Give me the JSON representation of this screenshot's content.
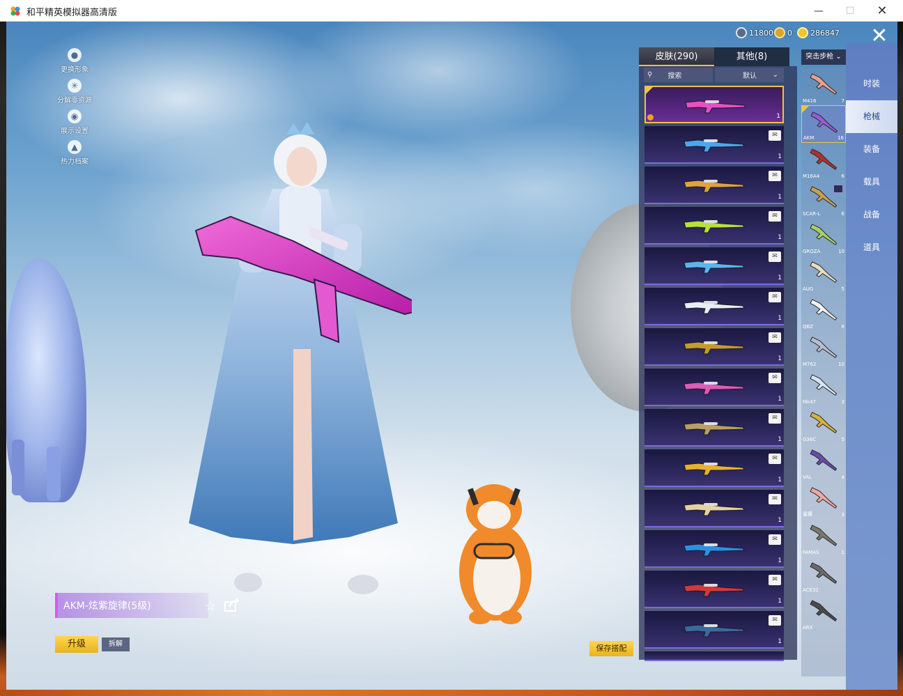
{
  "window": {
    "title": "和平精英模拟器高清版"
  },
  "side_menu": [
    {
      "label": "更换形象",
      "icon": "person-icon"
    },
    {
      "label": "分解零资源",
      "icon": "gear-icon"
    },
    {
      "label": "展示设置",
      "icon": "eye-icon"
    },
    {
      "label": "热力档案",
      "icon": "flame-icon"
    }
  ],
  "currencies": [
    {
      "value": "11800",
      "icon": "globe-coin-icon",
      "color": "#5a6a8a"
    },
    {
      "value": "0",
      "icon": "a-coin-icon",
      "color": "#d8a52a"
    },
    {
      "value": "286847",
      "icon": "gold-coin-icon",
      "color": "#f0c430"
    }
  ],
  "tabs": [
    {
      "label": "皮肤(290)",
      "active": true
    },
    {
      "label": "其他(8)",
      "active": false
    }
  ],
  "search": {
    "label": "搜索",
    "sort": "默认"
  },
  "skins": [
    {
      "color": "#e84fc6",
      "count": "1",
      "selected": true
    },
    {
      "color": "#4aa7f0",
      "count": "1"
    },
    {
      "color": "#e0a23a",
      "count": "1"
    },
    {
      "color": "#b8e03a",
      "count": "1"
    },
    {
      "color": "#58b6f2",
      "count": "1"
    },
    {
      "color": "#e8edf5",
      "count": "1"
    },
    {
      "color": "#c89a2a",
      "count": "1"
    },
    {
      "color": "#e05ab8",
      "count": "1"
    },
    {
      "color": "#b8a060",
      "count": "1"
    },
    {
      "color": "#e8b030",
      "count": "1"
    },
    {
      "color": "#e6d2a0",
      "count": "1"
    },
    {
      "color": "#2a90e8",
      "count": "1"
    },
    {
      "color": "#d03a3a",
      "count": "1"
    },
    {
      "color": "#3a6a9a",
      "count": "1"
    }
  ],
  "weapon_filter": {
    "label": "突击步枪"
  },
  "weapon_types": [
    {
      "name": "M416",
      "count": "7",
      "color": "#e8a090"
    },
    {
      "name": "AKM",
      "count": "16",
      "color": "#9a5ad8",
      "selected": true
    },
    {
      "name": "M16A4",
      "count": "6",
      "color": "#b03030"
    },
    {
      "name": "SCAR-L",
      "count": "6",
      "color": "#c8a050",
      "badge": true
    },
    {
      "name": "GROZA",
      "count": "10",
      "color": "#a8d060"
    },
    {
      "name": "AUG",
      "count": "5",
      "color": "#e8dcc0"
    },
    {
      "name": "QBZ",
      "count": "8",
      "color": "#f2f2f2"
    },
    {
      "name": "M762",
      "count": "10",
      "color": "#b8c0d0"
    },
    {
      "name": "Mk47",
      "count": "3",
      "color": "#d8e4f2"
    },
    {
      "name": "G36C",
      "count": "5",
      "color": "#d8b040"
    },
    {
      "name": "VAL",
      "count": "4",
      "color": "#6a4aa8"
    },
    {
      "name": "蜜獾",
      "count": "3",
      "color": "#f0a8a0"
    },
    {
      "name": "FAMAS",
      "count": "1",
      "color": "#7a7a6a"
    },
    {
      "name": "ACE32",
      "count": "",
      "color": "#6a6a6a"
    },
    {
      "name": "ARX",
      "count": "",
      "color": "#4a4a4a"
    }
  ],
  "categories": [
    {
      "label": "时装"
    },
    {
      "label": "枪械",
      "active": true
    },
    {
      "label": "装备"
    },
    {
      "label": "载具"
    },
    {
      "label": "战备"
    },
    {
      "label": "道具"
    }
  ],
  "current_skin": {
    "name": "AKM-炫紫旋律(5级)"
  },
  "buttons": {
    "upgrade": "升级",
    "dismantle": "拆解",
    "save": "保存搭配"
  }
}
